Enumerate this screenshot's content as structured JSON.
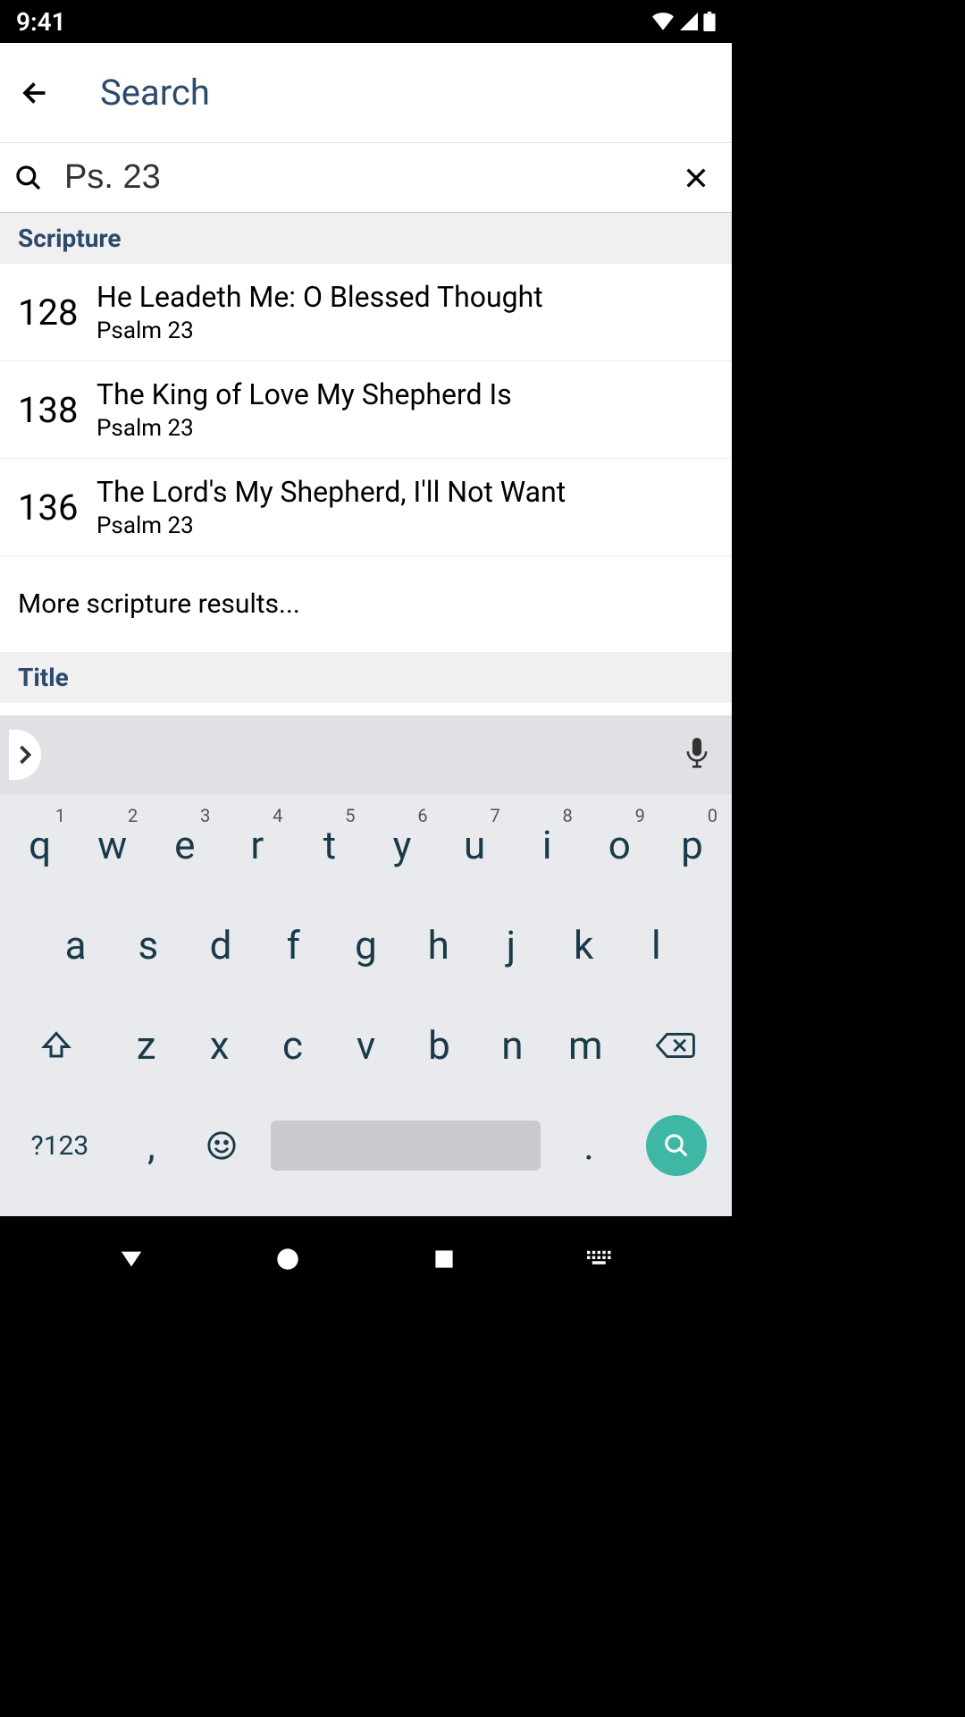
{
  "status": {
    "time": "9:41"
  },
  "header": {
    "title": "Search"
  },
  "search": {
    "value": "Ps. 23",
    "placeholder": ""
  },
  "sections": {
    "scripture": {
      "label": "Scripture",
      "items": [
        {
          "num": "128",
          "title": "He Leadeth Me: O Blessed Thought",
          "sub": "Psalm 23"
        },
        {
          "num": "138",
          "title": "The King of Love My Shepherd Is",
          "sub": "Psalm 23"
        },
        {
          "num": "136",
          "title": "The Lord's My Shepherd, I'll Not Want",
          "sub": "Psalm 23"
        }
      ],
      "more": "More scripture results..."
    },
    "title_section": {
      "label": "Title"
    }
  },
  "keyboard": {
    "row1": [
      {
        "k": "q",
        "n": "1"
      },
      {
        "k": "w",
        "n": "2"
      },
      {
        "k": "e",
        "n": "3"
      },
      {
        "k": "r",
        "n": "4"
      },
      {
        "k": "t",
        "n": "5"
      },
      {
        "k": "y",
        "n": "6"
      },
      {
        "k": "u",
        "n": "7"
      },
      {
        "k": "i",
        "n": "8"
      },
      {
        "k": "o",
        "n": "9"
      },
      {
        "k": "p",
        "n": "0"
      }
    ],
    "row2": [
      "a",
      "s",
      "d",
      "f",
      "g",
      "h",
      "j",
      "k",
      "l"
    ],
    "row3": [
      "z",
      "x",
      "c",
      "v",
      "b",
      "n",
      "m"
    ],
    "symbols": "?123",
    "comma": ",",
    "period": "."
  }
}
